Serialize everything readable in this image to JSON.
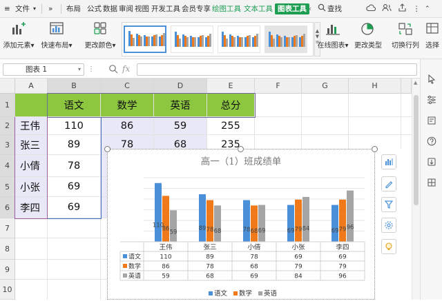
{
  "menu_bar": {
    "file_label": "文件",
    "more_label": "»",
    "tabs": [
      "布局",
      "公式",
      "数据",
      "审阅",
      "视图",
      "开发工具",
      "会员专享",
      "绘图工具",
      "文本工具",
      "图表工具"
    ],
    "search_label": "查找"
  },
  "ribbon": {
    "add_element": "添加元素",
    "quick_layout": "快速布局",
    "change_color": "更改颜色",
    "online_chart": "在线图表",
    "change_type": "更改类型",
    "switch_row_col": "切换行列",
    "select_data": "选择"
  },
  "formula_bar": {
    "name_box": "图表 1",
    "fx_label": "fx",
    "formula_value": ""
  },
  "sheet": {
    "columns": [
      "A",
      "B",
      "C",
      "D",
      "E",
      "F",
      "G",
      "H"
    ],
    "rows": [
      "1",
      "2",
      "3",
      "4",
      "5",
      "6",
      "7",
      "8",
      "9",
      "10"
    ],
    "header_row": [
      "",
      "语文",
      "数学",
      "英语",
      "总分"
    ],
    "data_rows": [
      [
        "王伟",
        "110",
        "86",
        "59",
        "255"
      ],
      [
        "张三",
        "89",
        "78",
        "68",
        "235"
      ],
      [
        "小倩",
        "78",
        "",
        "",
        ""
      ],
      [
        "小张",
        "69",
        "",
        "",
        ""
      ],
      [
        "李四",
        "69",
        "",
        "",
        ""
      ]
    ]
  },
  "colors": {
    "accent_green": "#1e9e53",
    "header_fill": "#8dc63f",
    "row_fill": "#e8e8f7",
    "series_chinese": "#4a90d9",
    "series_math": "#f07a1a",
    "series_english": "#a5a5a5"
  },
  "chart_data": {
    "type": "bar",
    "title": "高一（1）班成绩单",
    "categories": [
      "王伟",
      "张三",
      "小倩",
      "小张",
      "李四"
    ],
    "series": [
      {
        "name": "语文",
        "values": [
          110,
          89,
          78,
          69,
          69
        ]
      },
      {
        "name": "数学",
        "values": [
          86,
          78,
          68,
          79,
          79
        ]
      },
      {
        "name": "英语",
        "values": [
          59,
          68,
          69,
          84,
          96
        ]
      }
    ],
    "ylim": [
      0,
      120
    ],
    "grid": true,
    "data_labels": true,
    "data_table": true,
    "legend_position": "bottom"
  },
  "icons": {
    "toolbar": [
      "add-element-icon",
      "quick-layout-icon",
      "change-color-icon",
      "online-chart-icon",
      "change-type-icon",
      "switch-row-col-icon"
    ],
    "chart_side": [
      "chart-elements-icon",
      "chart-style-icon",
      "chart-filter-icon",
      "chart-settings-icon",
      "chart-tips-icon"
    ],
    "right_panel": [
      "select-arrow-icon",
      "property-icon",
      "format-icon",
      "help-icon",
      "backup-icon",
      "grid-icon"
    ]
  }
}
